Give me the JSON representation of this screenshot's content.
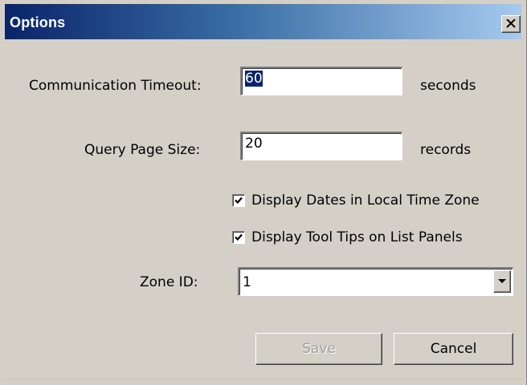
{
  "window": {
    "title": "Options",
    "close_glyph": "close-icon"
  },
  "form": {
    "timeout": {
      "label": "Communication Timeout:",
      "value": "60",
      "unit": "seconds"
    },
    "page_size": {
      "label": "Query Page Size:",
      "value": "20",
      "unit": "records"
    },
    "checkboxes": [
      {
        "label": "Display Dates in Local Time Zone",
        "checked": true
      },
      {
        "label": "Display Tool Tips on List Panels",
        "checked": true
      }
    ],
    "zone": {
      "label": "Zone ID:",
      "selected": "1"
    }
  },
  "buttons": {
    "save_label": "Save",
    "save_enabled": false,
    "cancel_label": "Cancel"
  },
  "colors": {
    "face": "#d4d0c8",
    "title_start": "#0a246a",
    "title_end": "#a6caf0",
    "selection": "#0a246a"
  }
}
